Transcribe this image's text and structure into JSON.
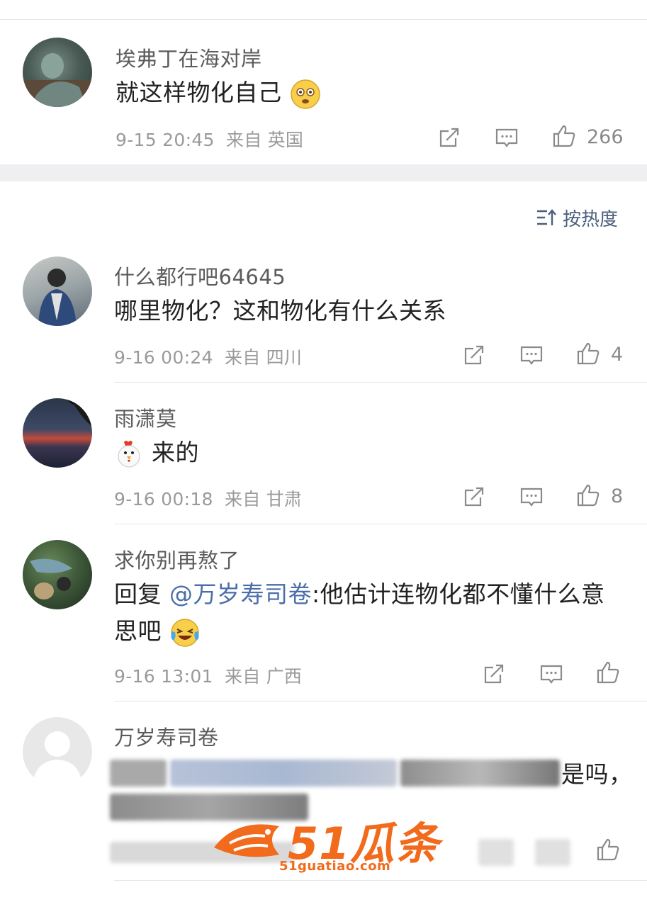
{
  "sort": {
    "label": "按热度"
  },
  "comments": [
    {
      "username": "埃弗丁在海对岸",
      "text": "就这样物化自己",
      "date": "9-15 20:45",
      "from_label": "来自",
      "location": "英国",
      "likes": "266"
    },
    {
      "username": "什么都行吧64645",
      "text": "哪里物化？这和物化有什么关系",
      "date": "9-16 00:24",
      "from_label": "来自",
      "location": "四川",
      "likes": "4"
    },
    {
      "username": "雨潇莫",
      "text": "来的",
      "date": "9-16 00:18",
      "from_label": "来自",
      "location": "甘肃",
      "likes": "8"
    },
    {
      "username": "求你别再熬了",
      "reply_prefix": "回复 ",
      "mention": "@万岁寿司卷",
      "text_line1": ":他估计连物化都不懂什么意",
      "text_line2": "思吧",
      "date": "9-16 13:01",
      "from_label": "来自",
      "location": "广西",
      "likes": ""
    },
    {
      "username": "万岁寿司卷",
      "visible_text_end": "是吗，"
    }
  ],
  "watermark": {
    "big": "51瓜条",
    "small": "51guatiao.com"
  },
  "colors": {
    "link": "#4a6ea8",
    "meta": "#9a9a9a",
    "watermark": "#f26a1b"
  }
}
